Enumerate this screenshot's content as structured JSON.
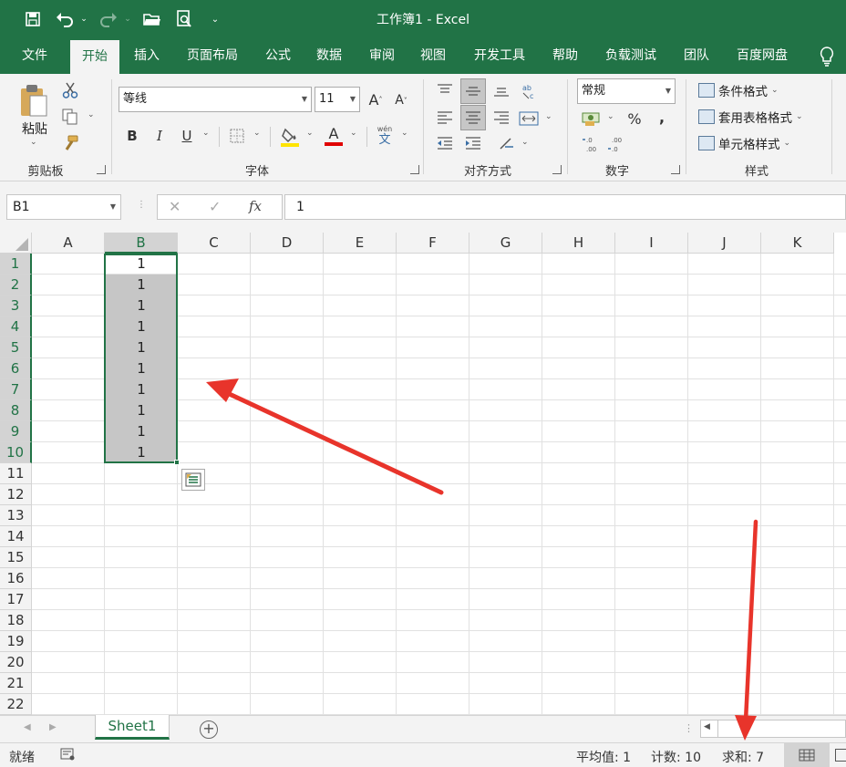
{
  "app": {
    "title": "工作簿1 - Excel"
  },
  "quick_access": [
    {
      "name": "save-icon",
      "glyph": "🖫"
    },
    {
      "name": "undo-icon",
      "glyph": "↶"
    },
    {
      "name": "redo-icon",
      "glyph": "↷"
    },
    {
      "name": "open-icon",
      "glyph": "📂"
    },
    {
      "name": "print-preview-icon",
      "glyph": "🔍"
    }
  ],
  "menu": {
    "tabs": [
      "文件",
      "开始",
      "插入",
      "页面布局",
      "公式",
      "数据",
      "审阅",
      "视图",
      "开发工具",
      "帮助",
      "负载测试",
      "团队",
      "百度网盘"
    ],
    "active_index": 1
  },
  "ribbon": {
    "clipboard": {
      "label": "剪贴板",
      "paste": "粘贴"
    },
    "font": {
      "label": "字体",
      "font_name": "等线",
      "font_size": "11",
      "bold": "B",
      "italic": "I",
      "underline": "U",
      "grow": "A",
      "shrink": "A",
      "fill_letter": "A",
      "wen": "wén",
      "wen2": "文"
    },
    "alignment": {
      "label": "对齐方式"
    },
    "number": {
      "label": "数字",
      "format": "常规",
      "percent": "%",
      "comma": ","
    },
    "styles": {
      "label": "样式",
      "conditional": "条件格式",
      "table": "套用表格格式",
      "cell": "单元格样式"
    }
  },
  "formula_bar": {
    "name_box": "B1",
    "cancel": "✕",
    "enter": "✓",
    "fx": "fx",
    "value": "1"
  },
  "grid": {
    "columns": [
      "A",
      "B",
      "C",
      "D",
      "E",
      "F",
      "G",
      "H",
      "I",
      "J",
      "K"
    ],
    "rows": [
      "1",
      "2",
      "3",
      "4",
      "5",
      "6",
      "7",
      "8",
      "9",
      "10",
      "11",
      "12",
      "13",
      "14",
      "15",
      "16",
      "17",
      "18",
      "19",
      "20",
      "21",
      "22"
    ],
    "selected_column": "B",
    "selected_rows": [
      "1",
      "2",
      "3",
      "4",
      "5",
      "6",
      "7",
      "8",
      "9",
      "10"
    ],
    "b_values": [
      "1",
      "1",
      "1",
      "1",
      "1",
      "1",
      "1",
      "1",
      "1",
      "1"
    ]
  },
  "sheets": {
    "tabs": [
      "Sheet1"
    ],
    "add": "+"
  },
  "status": {
    "mode": "就绪",
    "average": "平均值: 1",
    "count": "计数: 10",
    "sum": "求和: 7"
  },
  "colors": {
    "brand": "#217346",
    "annotation_arrow": "#e8342b",
    "selection_fill": "#c6c6c6"
  }
}
